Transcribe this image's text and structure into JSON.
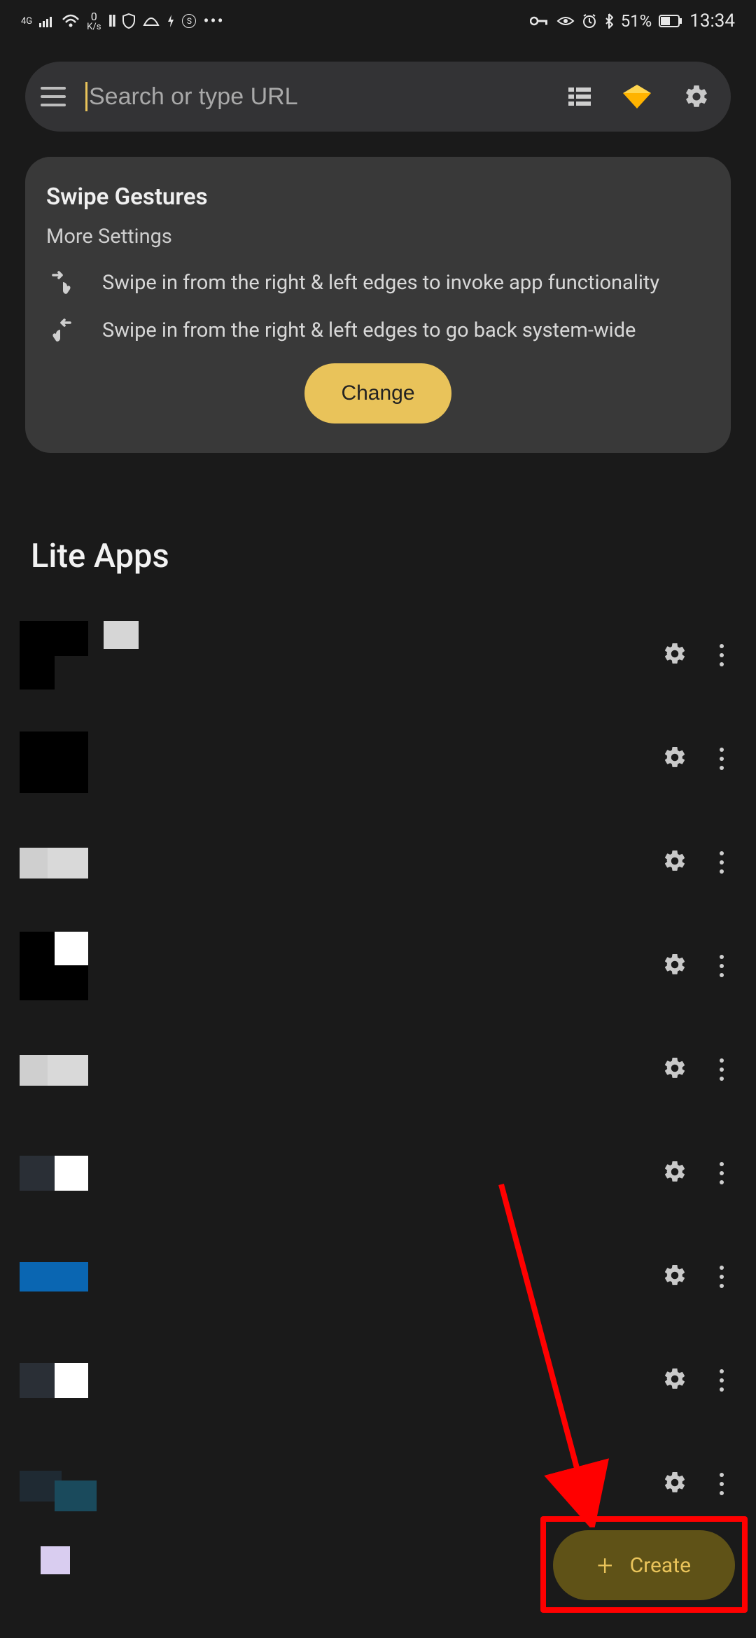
{
  "status_bar": {
    "network_label": "4G",
    "speed_top": "0",
    "speed_unit": "K/s",
    "battery_pct": "51%",
    "clock": "13:34"
  },
  "search": {
    "placeholder": "Search or type URL"
  },
  "card": {
    "title": "Swipe Gestures",
    "subtitle": "More Settings",
    "row1": "Swipe in from the right & left edges to invoke app functionality",
    "row2": "Swipe in from the right & left edges to go back system-wide",
    "change_label": "Change"
  },
  "section": {
    "lite_apps": "Lite Apps"
  },
  "fab": {
    "label": "Create"
  },
  "apps": [
    {
      "name": ""
    },
    {
      "name": ""
    },
    {
      "name": ""
    },
    {
      "name": ""
    },
    {
      "name": ""
    },
    {
      "name": ""
    },
    {
      "name": ""
    },
    {
      "name": ""
    },
    {
      "name": ""
    },
    {
      "name": ""
    }
  ]
}
